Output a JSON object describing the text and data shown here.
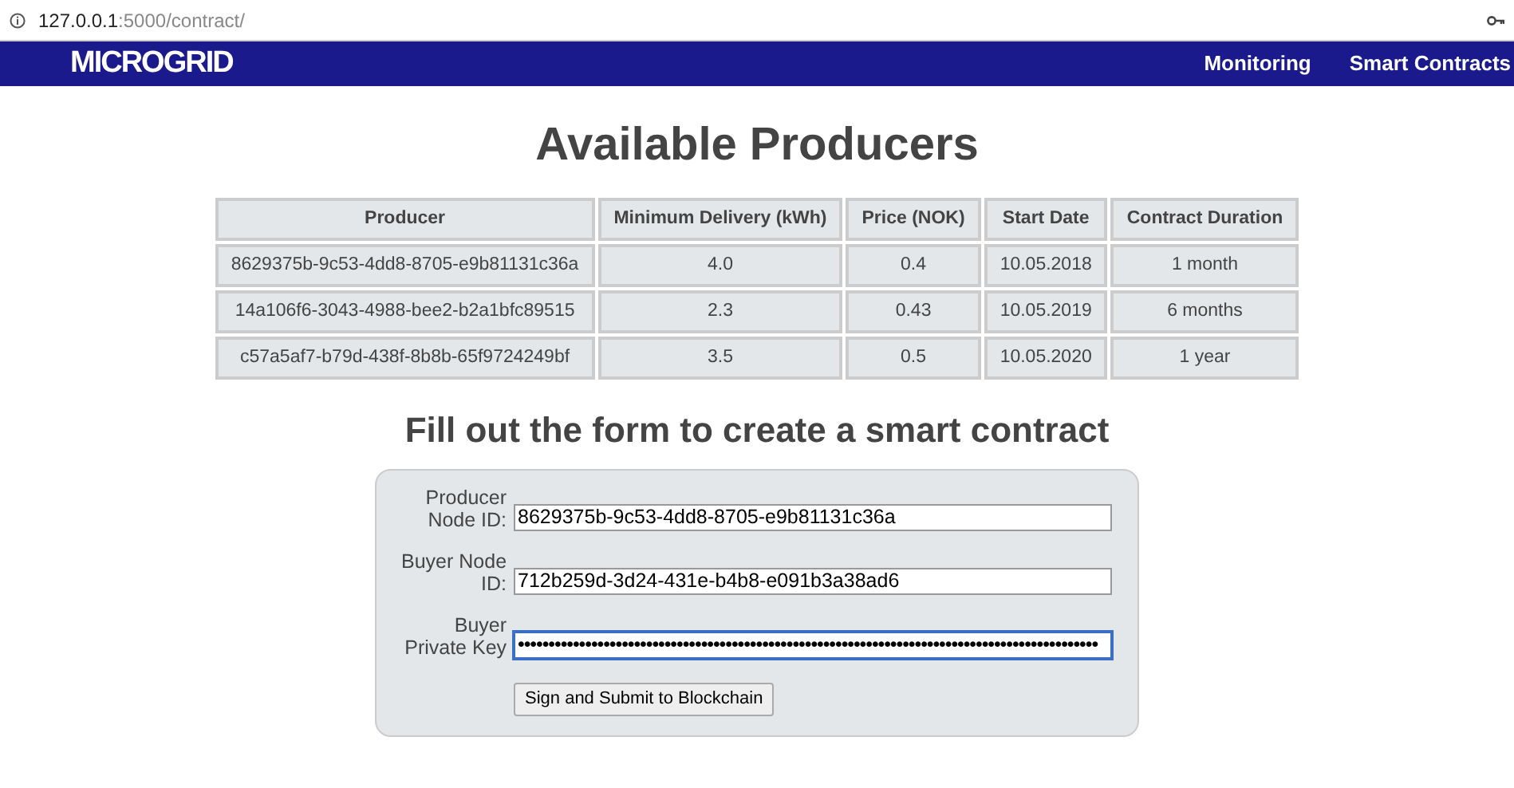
{
  "address_bar": {
    "url_host": "127.0.0.1",
    "url_rest": ":5000/contract/"
  },
  "navbar": {
    "brand": "MICROGRID",
    "links": [
      {
        "label": "Monitoring",
        "selected": false
      },
      {
        "label": "Smart Contracts",
        "selected": false
      }
    ]
  },
  "title": "Available Producers",
  "table": {
    "columns": [
      "Producer",
      "Minimum Delivery (kWh)",
      "Price (NOK)",
      "Start Date",
      "Contract Duration"
    ],
    "rows": [
      [
        "8629375b-9c53-4dd8-8705-e9b81131c36a",
        "4.0",
        "0.4",
        "10.05.2018",
        "1 month"
      ],
      [
        "14a106f6-3043-4988-bee2-b2a1bfc89515",
        "2.3",
        "0.43",
        "10.05.2019",
        "6 months"
      ],
      [
        "c57a5af7-b79d-438f-8b8b-65f9724249bf",
        "3.5",
        "0.5",
        "10.05.2020",
        "1 year"
      ]
    ]
  },
  "form": {
    "heading": "Fill out the form to create a smart contract",
    "fields": [
      {
        "label_lines": [
          "Producer",
          "Node ID:"
        ],
        "value": "8629375b-9c53-4dd8-8705-e9b81131c36a",
        "focused": false
      },
      {
        "label_lines": [
          "Buyer Node",
          "ID:"
        ],
        "value": "712b259d-3d24-431e-b4b8-e091b3a38ad6",
        "focused": false
      },
      {
        "label_lines": [
          "Buyer",
          "Private Key"
        ],
        "value": "•••••••••••••••••••••••••••••••••••••••••••••••••••••••••••••••••••••••••••••••••••••••••••••••",
        "focused": true
      }
    ],
    "submit": "Sign and Submit to Blockchain"
  }
}
